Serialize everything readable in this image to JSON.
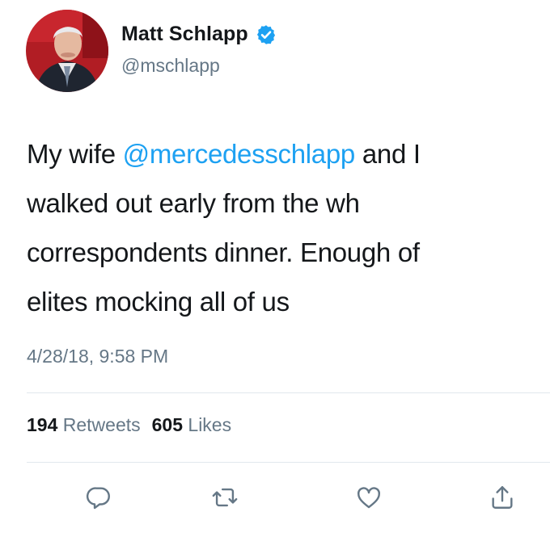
{
  "author": {
    "display_name": "Matt Schlapp",
    "handle": "@mschlapp",
    "verified": true
  },
  "tweet": {
    "lines": [
      {
        "before": "My wife ",
        "mention": "@mercedesschlapp",
        "after": " and I"
      },
      {
        "text": "walked out early from the wh"
      },
      {
        "text": "correspondents dinner. Enough of"
      },
      {
        "text": "elites mocking all of us"
      }
    ],
    "timestamp": "4/28/18, 9:58 PM"
  },
  "stats": {
    "retweets_count": "194",
    "retweets_label": "Retweets",
    "likes_count": "605",
    "likes_label": "Likes"
  },
  "actions": {
    "reply_icon": "reply-icon",
    "retweet_icon": "retweet-icon",
    "like_icon": "heart-icon",
    "share_icon": "share-icon"
  },
  "colors": {
    "accent": "#1da1f2",
    "text_primary": "#14171a",
    "text_secondary": "#657786",
    "divider": "#e1e8ed"
  }
}
